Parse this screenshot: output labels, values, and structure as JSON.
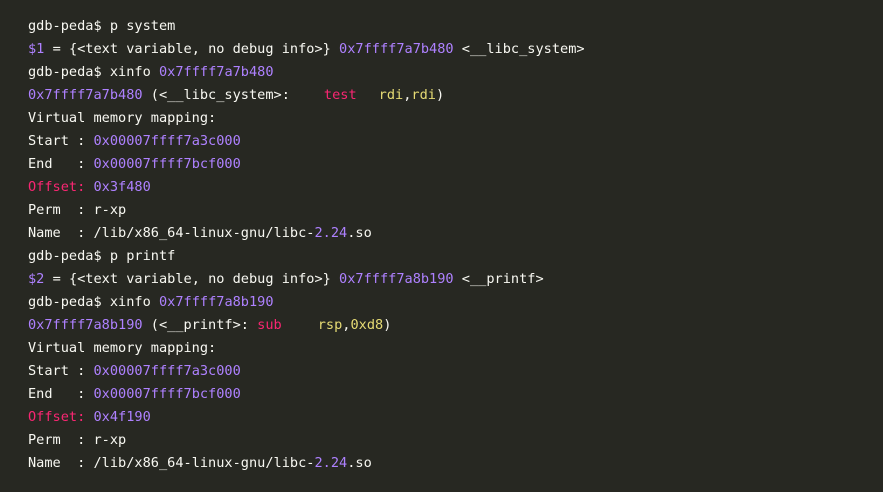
{
  "colors": {
    "background": "#272822",
    "text": "#f8f8f2",
    "number": "#ae81ff",
    "keyword": "#f92672",
    "register": "#e6db74"
  },
  "session1": {
    "cmd_p": {
      "prompt": "gdb-peda$",
      "command": "p system"
    },
    "result": {
      "var": "$1",
      "eq": "=",
      "text": "{<text variable, no debug info>}",
      "addr": "0x7ffff7a7b480",
      "symbol": "<__libc_system>"
    },
    "cmd_xinfo": {
      "prompt": "gdb-peda$",
      "command": "xinfo",
      "arg": "0x7ffff7a7b480"
    },
    "disasm": {
      "addr": "0x7ffff7a7b480",
      "symbol": "(<__libc_system>:",
      "mnemonic": "test",
      "op1": "rdi",
      "comma": ",",
      "op2": "rdi",
      "close": ")"
    },
    "mapping_header": "Virtual memory mapping:",
    "start": {
      "label": "Start :",
      "value": "0x00007ffff7a3c000"
    },
    "end": {
      "label": "End   :",
      "value": "0x00007ffff7bcf000"
    },
    "offset": {
      "label": "Offset:",
      "value": "0x3f480"
    },
    "perm": {
      "label": "Perm  :",
      "value": "r-xp"
    },
    "name": {
      "label": "Name  :",
      "path": "/lib/x86_64-linux-gnu/libc-",
      "version": "2.24",
      "ext": ".so"
    }
  },
  "session2": {
    "cmd_p": {
      "prompt": "gdb-peda$",
      "command": "p printf"
    },
    "result": {
      "var": "$2",
      "eq": "=",
      "text": "{<text variable, no debug info>}",
      "addr": "0x7ffff7a8b190",
      "symbol": "<__printf>"
    },
    "cmd_xinfo": {
      "prompt": "gdb-peda$",
      "command": "xinfo",
      "arg": "0x7ffff7a8b190"
    },
    "disasm": {
      "addr": "0x7ffff7a8b190",
      "symbol": "(<__printf>:",
      "mnemonic": "sub",
      "op1": "rsp",
      "comma": ",",
      "op2": "0xd8",
      "close": ")"
    },
    "mapping_header": "Virtual memory mapping:",
    "start": {
      "label": "Start :",
      "value": "0x00007ffff7a3c000"
    },
    "end": {
      "label": "End   :",
      "value": "0x00007ffff7bcf000"
    },
    "offset": {
      "label": "Offset:",
      "value": "0x4f190"
    },
    "perm": {
      "label": "Perm  :",
      "value": "r-xp"
    },
    "name": {
      "label": "Name  :",
      "path": "/lib/x86_64-linux-gnu/libc-",
      "version": "2.24",
      "ext": ".so"
    }
  }
}
